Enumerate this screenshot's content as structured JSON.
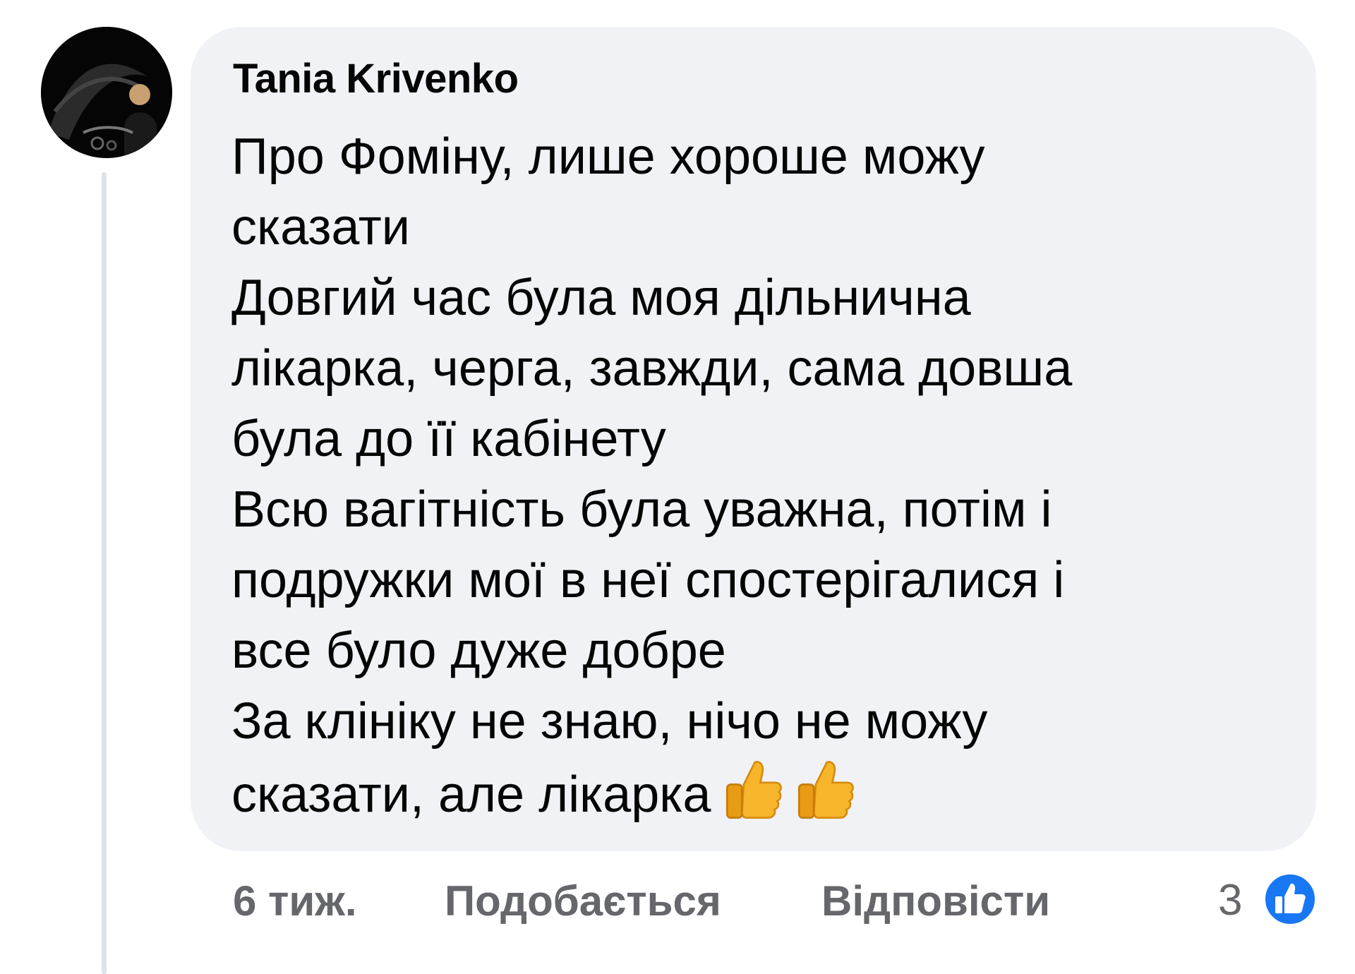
{
  "comment": {
    "author": "Tania Krivenko",
    "text_lines": [
      "Про Фоміну, лише хороше можу",
      "сказати",
      "Довгий час була моя дільнична",
      "лікарка, черга, завжди, сама довша",
      "була до її кабінету",
      "Всю вагітність була уважна, потім і",
      "подружки мої в неї спостерігалися і",
      "все було дуже добре",
      "За клініку не знаю, нічо не можу",
      "сказати, але лікарка"
    ],
    "emojis": [
      "thumbs-up-emoji",
      "thumbs-up-emoji"
    ]
  },
  "actions": {
    "time": "6 тиж.",
    "like_label": "Подобається",
    "reply_label": "Відповісти"
  },
  "reactions": {
    "count": "3",
    "icon": "like-icon",
    "color": "#1877f2"
  },
  "colors": {
    "bubble": "#f0f2f5",
    "text": "#050505",
    "secondary": "#65676b",
    "thread_line": "#dfe3e8"
  }
}
